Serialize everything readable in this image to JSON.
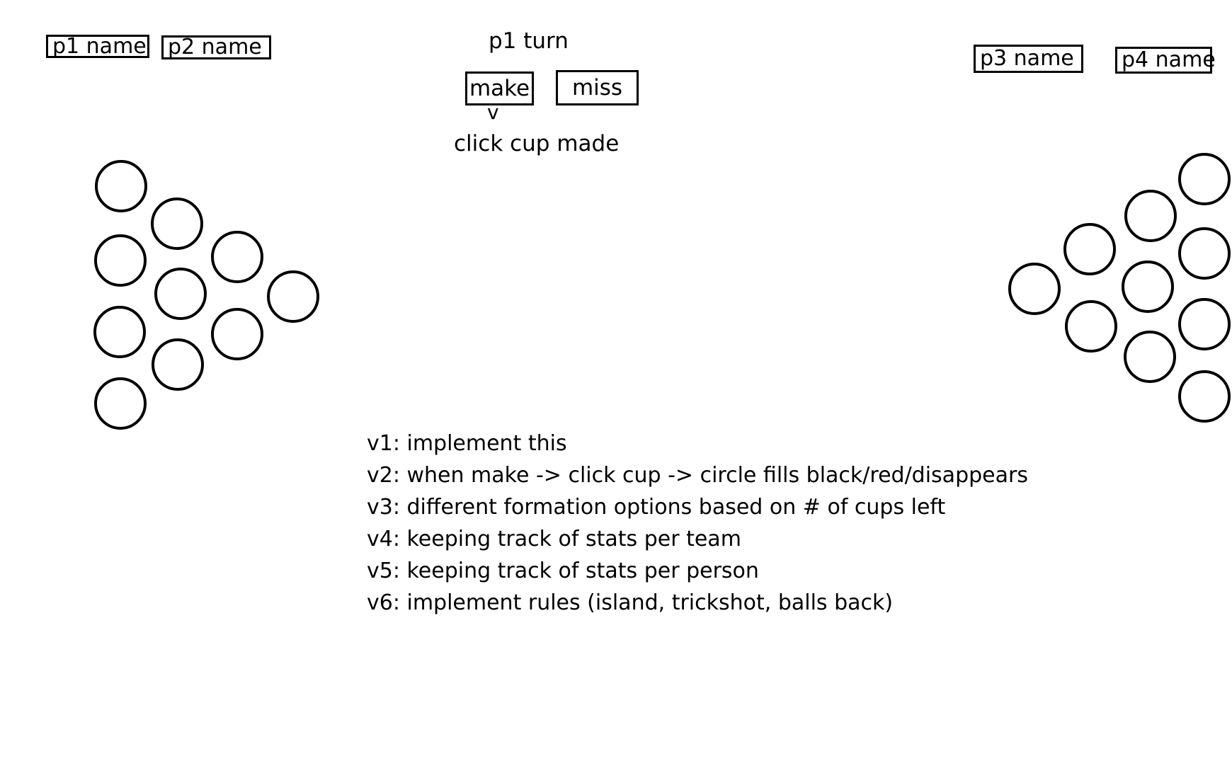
{
  "players": {
    "p1": "p1 name",
    "p2": "p2 name",
    "p3": "p3 name",
    "p4": "p4 name"
  },
  "turn": {
    "label": "p1 turn",
    "make_label": "make",
    "miss_label": "miss",
    "arrow": "v",
    "instruction": "click cup made"
  },
  "teams": {
    "left": {
      "cups_remaining": 10
    },
    "right": {
      "cups_remaining": 10
    }
  },
  "roadmap": [
    "v1: implement this",
    "v2: when make -> click cup -> circle fills black/red/disappears",
    "v3: different formation options based on # of cups left",
    "v4: keeping track of stats per team",
    "v5: keeping track of stats per person",
    "v6: implement rules (island, trickshot, balls back)"
  ],
  "colors": {
    "background": "#ffffff",
    "ink": "#000000"
  }
}
